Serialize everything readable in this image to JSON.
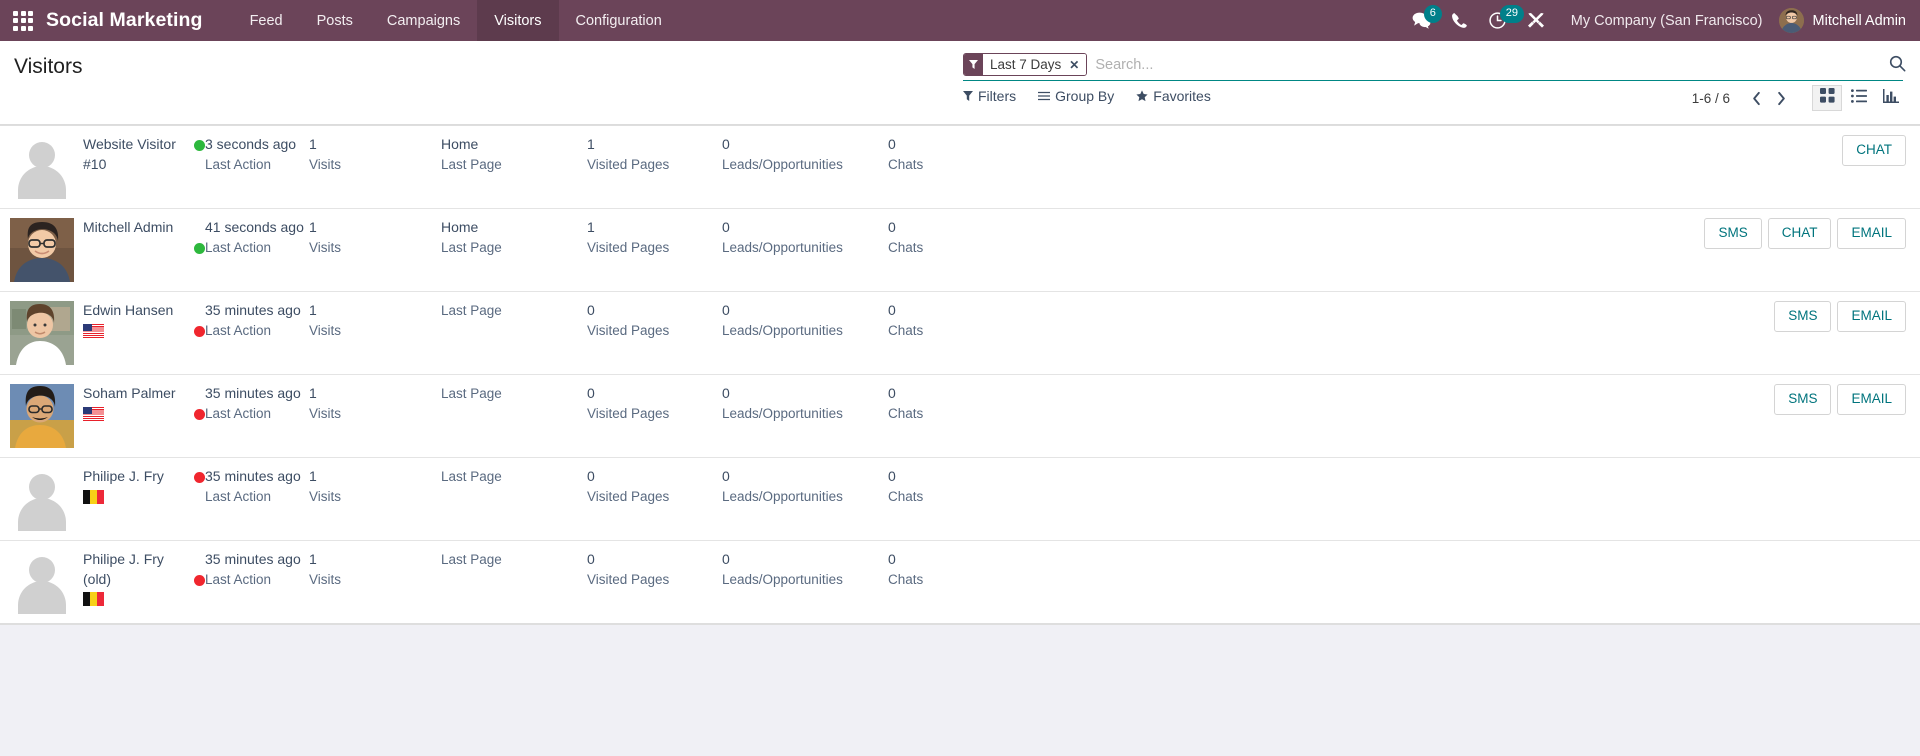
{
  "navbar": {
    "apps_icon": "apps-grid-icon",
    "brand": "Social Marketing",
    "menu_items": [
      {
        "label": "Feed",
        "active": false
      },
      {
        "label": "Posts",
        "active": false
      },
      {
        "label": "Campaigns",
        "active": false
      },
      {
        "label": "Visitors",
        "active": true
      },
      {
        "label": "Configuration",
        "active": false
      }
    ],
    "messages_icon": "messages-icon",
    "messages_badge": "6",
    "phone_icon": "phone-icon",
    "activities_icon": "activities-clock-icon",
    "activities_badge": "29",
    "debug_icon": "debug-tools-icon",
    "company": "My Company (San Francisco)",
    "user": "Mitchell Admin",
    "brand_color": "#6b4459",
    "badge_color": "#00808a"
  },
  "control_panel": {
    "title": "Visitors",
    "facet": {
      "icon": "filter-funnel-icon",
      "label": "Last 7 Days",
      "close": "✕"
    },
    "search_placeholder": "Search...",
    "search_value": "",
    "search_icon": "search-magnifier-icon",
    "buttons": [
      {
        "label": "Filters",
        "icon": "filter-funnel-icon"
      },
      {
        "label": "Group By",
        "icon": "hamburger-lines-icon"
      },
      {
        "label": "Favorites",
        "icon": "star-icon"
      }
    ],
    "pager": {
      "count": "1-6 / 6",
      "prev_icon": "chevron-left-icon",
      "next_icon": "chevron-right-icon"
    },
    "views": [
      {
        "name": "kanban",
        "icon": "kanban-grid-icon",
        "active": true
      },
      {
        "name": "list",
        "icon": "list-icon",
        "active": false
      },
      {
        "name": "graph",
        "icon": "bar-chart-icon",
        "active": false
      }
    ]
  },
  "labels": {
    "last_action": "Last Action",
    "visits": "Visits",
    "last_page": "Last Page",
    "visited_pages": "Visited Pages",
    "leads": "Leads/Opportunities",
    "chats": "Chats"
  },
  "rows": [
    {
      "name": "Website Visitor #10",
      "avatar": "placeholder",
      "status": "online",
      "flag": null,
      "last_action": "3 seconds ago",
      "visits": "1",
      "last_page": "Home",
      "visited_pages": "1",
      "leads": "0",
      "chats": "0",
      "actions": [
        "CHAT"
      ]
    },
    {
      "name": "Mitchell Admin",
      "avatar": "photo-mitchell",
      "status": "online",
      "flag": null,
      "last_action": "41 seconds ago",
      "visits": "1",
      "last_page": "Home",
      "visited_pages": "1",
      "leads": "0",
      "chats": "0",
      "actions": [
        "SMS",
        "CHAT",
        "EMAIL"
      ]
    },
    {
      "name": "Edwin Hansen",
      "avatar": "photo-edwin",
      "status": "offline",
      "flag": "us",
      "last_action": "35 minutes ago",
      "visits": "1",
      "last_page": "",
      "visited_pages": "0",
      "leads": "0",
      "chats": "0",
      "actions": [
        "SMS",
        "EMAIL"
      ]
    },
    {
      "name": "Soham Palmer",
      "avatar": "photo-soham",
      "status": "offline",
      "flag": "us",
      "last_action": "35 minutes ago",
      "visits": "1",
      "last_page": "",
      "visited_pages": "0",
      "leads": "0",
      "chats": "0",
      "actions": [
        "SMS",
        "EMAIL"
      ]
    },
    {
      "name": "Philipe J. Fry",
      "avatar": "placeholder",
      "status": "offline",
      "flag": "be",
      "last_action": "35 minutes ago",
      "visits": "1",
      "last_page": "",
      "visited_pages": "0",
      "leads": "0",
      "chats": "0",
      "actions": []
    },
    {
      "name": "Philipe J. Fry (old)",
      "avatar": "placeholder",
      "status": "offline",
      "flag": "be",
      "last_action": "35 minutes ago",
      "visits": "1",
      "last_page": "",
      "visited_pages": "0",
      "leads": "0",
      "chats": "0",
      "actions": []
    }
  ]
}
